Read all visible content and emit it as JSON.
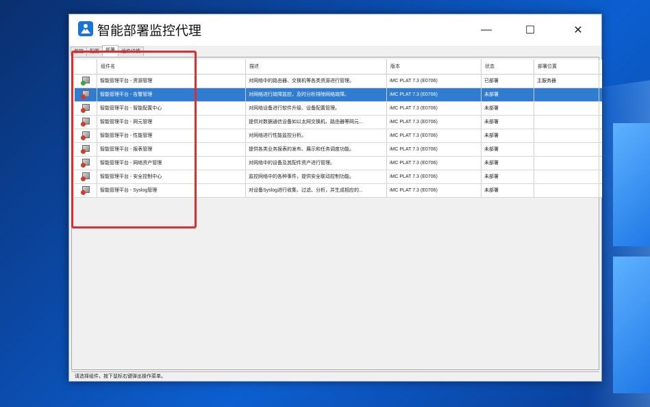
{
  "window": {
    "title": "智能部署监控代理",
    "controls": {
      "minimize": "—",
      "maximize": "☐",
      "close": "✕"
    }
  },
  "tabs": [
    {
      "label": "监控"
    },
    {
      "label": "配置"
    },
    {
      "label": "部署"
    },
    {
      "label": "组件详情"
    }
  ],
  "table": {
    "columns": [
      "",
      "组件名",
      "描述",
      "版本",
      "状态",
      "部署位置"
    ],
    "rows": [
      {
        "status_icon": "ok",
        "name": "智能管理平台 - 资源管理",
        "desc": "对网络中的路由器、交换机等各类资源进行管理。",
        "version": "iMC PLAT 7.3 (E0706)",
        "state": "已部署",
        "location": "主服务器"
      },
      {
        "status_icon": "warn",
        "name": "智能管理平台 - 告警管理",
        "desc": "对网络进行故障监控，及时分析排除网络故障。",
        "version": "iMC PLAT 7.3 (E0706)",
        "state": "未部署",
        "location": ""
      },
      {
        "status_icon": "warn",
        "name": "智能管理平台 - 智能配置中心",
        "desc": "对网络设备进行软件升级、设备配置管理。",
        "version": "iMC PLAT 7.3 (E0706)",
        "state": "未部署",
        "location": ""
      },
      {
        "status_icon": "warn",
        "name": "智能管理平台 - 网元管理",
        "desc": "提供对数据通信设备如以太网交换机、路由器等网元...",
        "version": "iMC PLAT 7.3 (E0706)",
        "state": "未部署",
        "location": ""
      },
      {
        "status_icon": "warn",
        "name": "智能管理平台 - 性能管理",
        "desc": "对网络进行性能监控分析。",
        "version": "iMC PLAT 7.3 (E0706)",
        "state": "未部署",
        "location": ""
      },
      {
        "status_icon": "warn",
        "name": "智能管理平台 - 报表管理",
        "desc": "提供各类业务报表的发布、展示和任务调度功能。",
        "version": "iMC PLAT 7.3 (E0706)",
        "state": "未部署",
        "location": ""
      },
      {
        "status_icon": "warn",
        "name": "智能管理平台 - 网络资产管理",
        "desc": "对网络中的设备及其配件资产进行管理。",
        "version": "iMC PLAT 7.3 (E0706)",
        "state": "未部署",
        "location": ""
      },
      {
        "status_icon": "warn",
        "name": "智能管理平台 - 安全控制中心",
        "desc": "监控网络中的各种事件，提供安全联动控制功能。",
        "version": "iMC PLAT 7.3 (E0706)",
        "state": "未部署",
        "location": ""
      },
      {
        "status_icon": "warn",
        "name": "智能管理平台 - Syslog管理",
        "desc": "对设备Syslog进行收集、过滤、分析，并生成相应的...",
        "version": "iMC PLAT 7.3 (E0706)",
        "state": "未部署",
        "location": ""
      }
    ],
    "selected_row": 1
  },
  "statusbar": {
    "text": "请选择组件，按下鼠标右键弹出操作菜单。"
  },
  "colors": {
    "selection": "#2f7cd0",
    "highlight": "#e32b2b",
    "app_icon": "#1a73d9"
  }
}
